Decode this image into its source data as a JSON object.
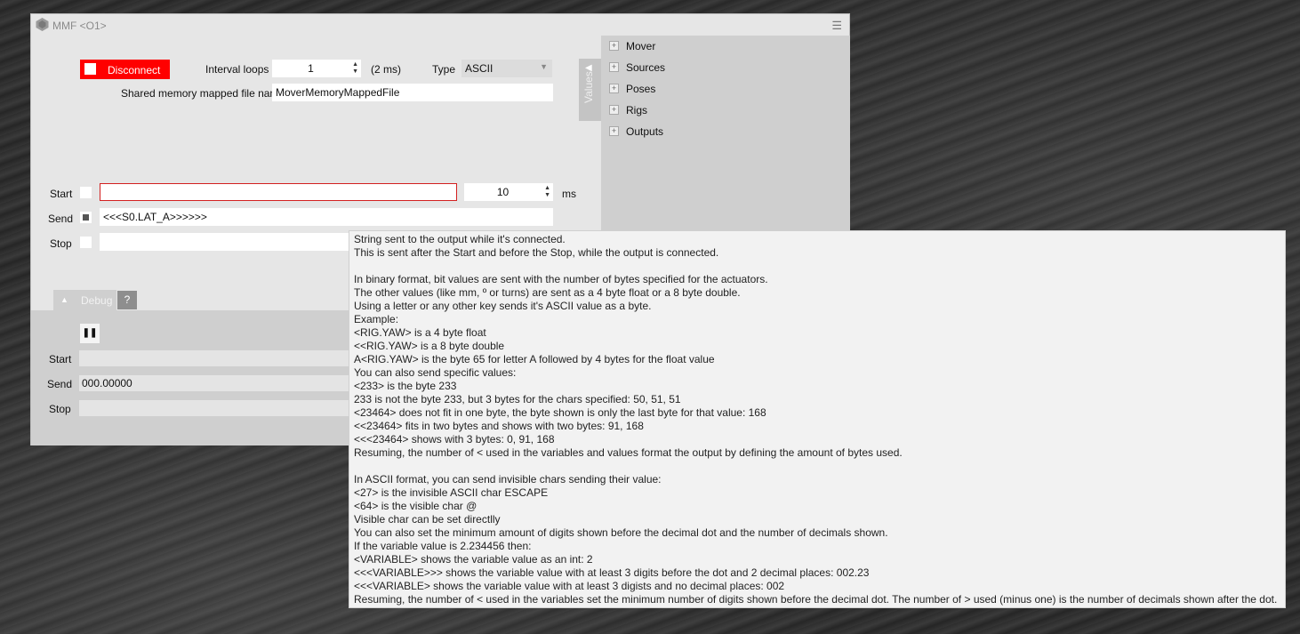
{
  "window": {
    "title": "MMF <O1>"
  },
  "connection": {
    "disconnect_label": "Disconnect",
    "interval_label": "Interval loops",
    "interval_value": "1",
    "interval_ms": "(2 ms)",
    "type_label": "Type",
    "type_value": "ASCII",
    "mmf_label": "Shared memory mapped file name",
    "mmf_value": "MoverMemoryMappedFile"
  },
  "values_panel": {
    "tab_label": "Values",
    "items": [
      "Mover",
      "Sources",
      "Poses",
      "Rigs",
      "Outputs"
    ]
  },
  "strings": {
    "start_label": "Start",
    "start_value": "",
    "start_interval": "10",
    "start_unit": "ms",
    "send_label": "Send",
    "send_value": "<<<S0.LAT_A>>>>>>",
    "stop_label": "Stop",
    "stop_value": ""
  },
  "debug": {
    "tab_label": "Debug",
    "help_label": "?",
    "start_label": "Start",
    "start_value": "",
    "send_label": "Send",
    "send_value": "000.00000",
    "stop_label": "Stop",
    "stop_value": ""
  },
  "tooltip": {
    "lines": [
      "String sent to the output while it's connected.",
      "This is sent after the Start and before the Stop, while the output is connected.",
      "",
      "In binary format, bit values are sent with the number of bytes specified for the actuators.",
      "The other values (like mm, º or turns) are sent as a 4 byte float or a 8 byte double.",
      "Using a letter or any other key sends it's ASCII value as a byte.",
      "Example:",
      "<RIG.YAW> is a 4 byte float",
      "<<RIG.YAW> is a 8 byte double",
      "A<RIG.YAW> is the byte 65 for letter A followed by 4 bytes for the float value",
      "You can also send specific values:",
      "<233> is the byte 233",
      "233 is not the byte 233, but 3 bytes for the chars specified: 50, 51, 51",
      "<23464> does not fit in one byte, the byte shown is only the last byte for that value: 168",
      "<<23464> fits in two bytes and shows with two bytes: 91, 168",
      "<<<23464> shows with 3 bytes: 0, 91, 168",
      "Resuming, the number of < used in the variables and values format the output by defining the amount of bytes used.",
      "",
      "In ASCII format, you can send invisible chars sending their value:",
      "<27> is the invisible ASCII char ESCAPE",
      "<64> is the visible char @",
      "Visible char can be set directlly",
      "You can also set the minimum amount of digits shown before the decimal dot and the number of decimals shown.",
      "If the variable value is 2.234456 then:",
      "<VARIABLE> shows the variable value as an int: 2",
      "<<<VARIABLE>>> shows the variable value with at least 3 digits before the dot and 2 decimal places: 002.23",
      "<<<VARIABLE> shows the variable value with at least 3 digists and no decimal places: 002",
      "Resuming, the number of < used in the variables set the minimum number of digits shown before the decimal dot. The number of > used (minus one) is the number of decimals shown after the dot."
    ]
  }
}
